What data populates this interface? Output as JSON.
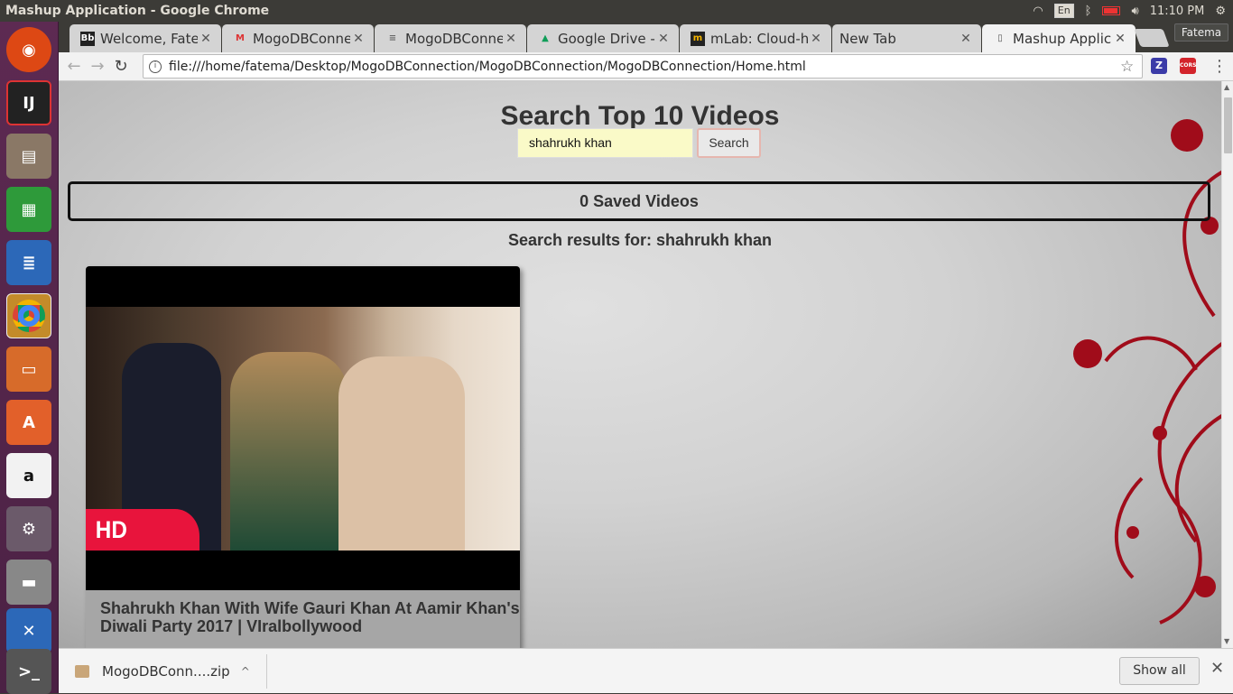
{
  "window": {
    "title": "Mashup Application - Google Chrome"
  },
  "indicators": {
    "lang": "En",
    "time": "11:10 PM"
  },
  "tabs": [
    {
      "label": "Welcome, Fatema",
      "fav": "Bb"
    },
    {
      "label": "MogoDBConnection",
      "fav": "M"
    },
    {
      "label": "MogoDBConnection",
      "fav": "≡"
    },
    {
      "label": "Google Drive - V",
      "fav": "▲"
    },
    {
      "label": "mLab: Cloud-hosted",
      "fav": "m"
    },
    {
      "label": "New Tab",
      "fav": ""
    },
    {
      "label": "Mashup Application",
      "fav": "▯"
    }
  ],
  "profile": "Fatema",
  "address": {
    "url": "file:///home/fatema/Desktop/MogoDBConnection/MogoDBConnection/MogoDBConnection/Home.html"
  },
  "extensions": {
    "z": "Z",
    "cors": "CORS"
  },
  "page": {
    "title": "Search Top 10 Videos",
    "search_value": "shahrukh khan",
    "search_button": "Search",
    "saved_videos": "0 Saved Videos",
    "results_heading": "Search results for: shahrukh khan",
    "videos": [
      {
        "badge": "HD VIDEO",
        "title": "Shahrukh Khan With Wife Gauri Khan At Aamir Khan's Diwali Party 2017 | VIralbollywood"
      }
    ]
  },
  "download": {
    "file": "MogoDBConn....zip",
    "show_all": "Show all"
  },
  "colors": {
    "launcher": "#5d2a52",
    "hd_badge": "#e8143c",
    "search_input_bg": "#fafac8",
    "floral": "#a00c1a"
  }
}
